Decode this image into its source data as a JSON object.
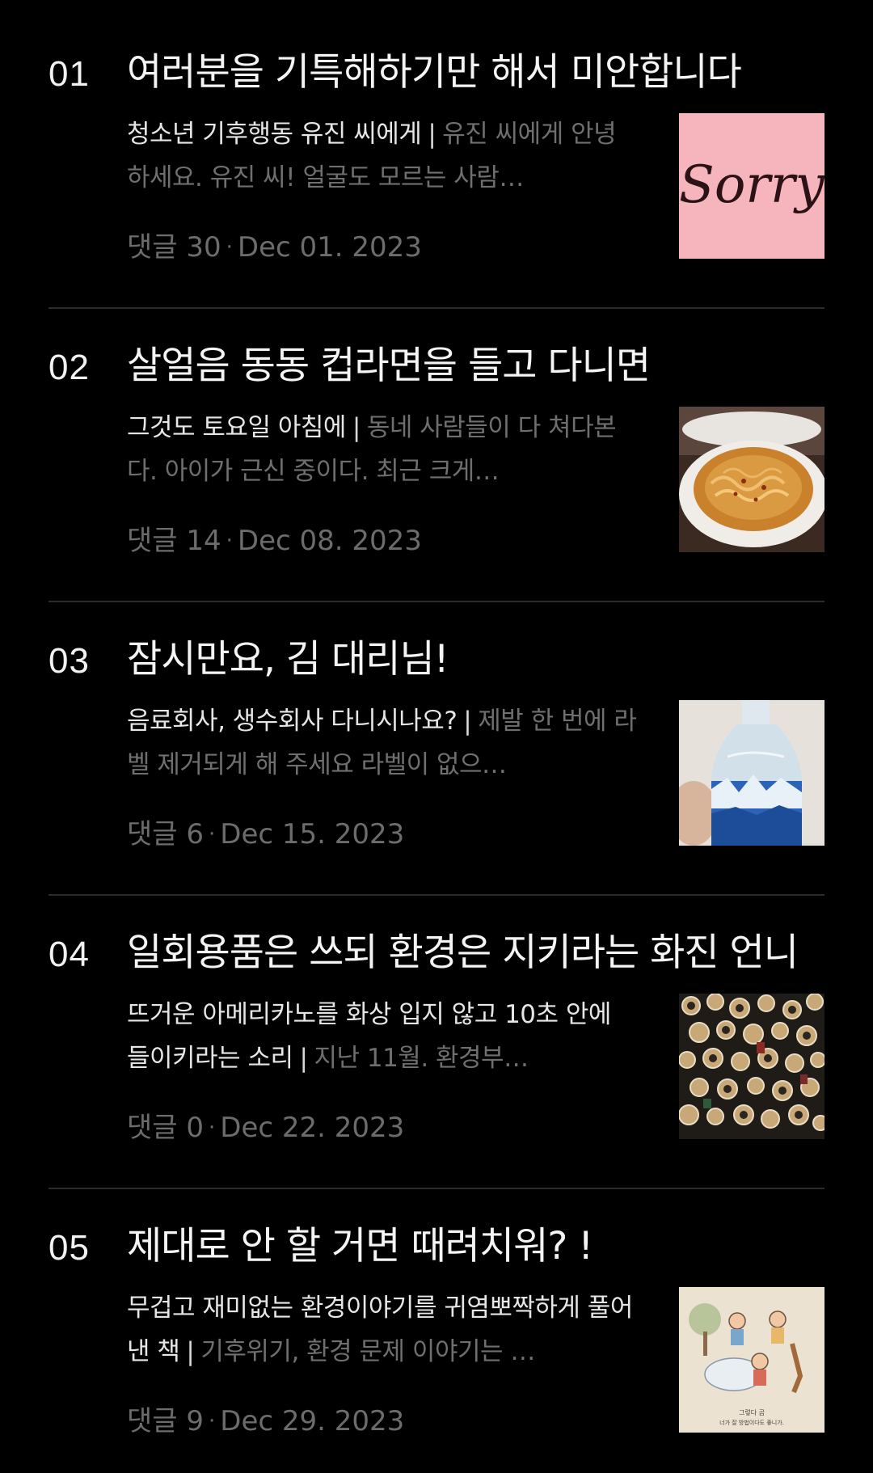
{
  "articles": [
    {
      "rank": "01",
      "title": "여러분을 기특해하기만 해서 미안합니다",
      "subtitle": "청소년 기후행동 유진 씨에게",
      "separator": "|",
      "excerpt": "유진 씨에게 안녕하세요. 유진 씨! 얼굴도 모르는 사람…",
      "comments_label": "댓글 30",
      "dot": "·",
      "date": "Dec 01. 2023",
      "thumb_text": "Sorry"
    },
    {
      "rank": "02",
      "title": "살얼음 동동 컵라면을 들고 다니면",
      "subtitle": "그것도 토요일 아침에",
      "separator": "|",
      "excerpt": "동네 사람들이 다 쳐다본다. 아이가 근신 중이다. 최근 크게…",
      "comments_label": "댓글 14",
      "dot": "·",
      "date": "Dec 08. 2023"
    },
    {
      "rank": "03",
      "title": "잠시만요, 김 대리님!",
      "subtitle": "음료회사, 생수회사 다니시나요?",
      "separator": "|",
      "excerpt": "제발 한 번에 라벨 제거되게 해 주세요 라벨이 없으…",
      "comments_label": "댓글 6",
      "dot": "·",
      "date": "Dec 15. 2023"
    },
    {
      "rank": "04",
      "title": "일회용품은 쓰되 환경은 지키라는 화진 언니",
      "subtitle": "뜨거운 아메리카노를 화상 입지 않고 10초 안에 들이키라는 소리",
      "separator": "|",
      "excerpt": "지난 11월. 환경부…",
      "comments_label": "댓글 0",
      "dot": "·",
      "date": "Dec 22. 2023"
    },
    {
      "rank": "05",
      "title": "제대로 안 할 거면 때려치워? !",
      "subtitle": "무겁고 재미없는 환경이야기를 귀염뽀짝하게 풀어낸 책",
      "separator": "|",
      "excerpt": "기후위기, 환경 문제 이야기는 …",
      "comments_label": "댓글 9",
      "dot": "·",
      "date": "Dec 29. 2023",
      "thumb_caption_1": "그렇다 곰",
      "thumb_caption_2": "너가 잘 방법이다도 좋니가."
    }
  ],
  "colors": {
    "background": "#000000",
    "title": "#f4f4f4",
    "subtitle": "#e6e6e6",
    "excerpt": "#6f6f6f",
    "meta": "#6c6c6c",
    "divider": "#2a2a2a"
  }
}
